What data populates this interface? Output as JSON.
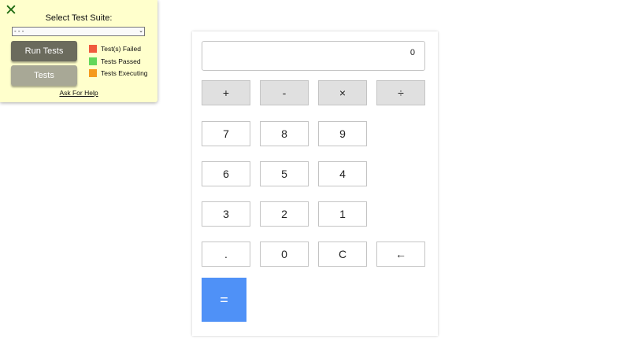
{
  "test_panel": {
    "close_icon_glyph": "✕",
    "title": "Select Test Suite:",
    "suite_select": {
      "selected": "- - -",
      "chevron": "⌄"
    },
    "run_button": "Run Tests",
    "tests_button": "Tests",
    "legend": [
      {
        "label": "Test(s) Failed",
        "color": "#f05a3c"
      },
      {
        "label": "Tests Passed",
        "color": "#62d75a"
      },
      {
        "label": "Tests Executing",
        "color": "#f59a1c"
      }
    ],
    "help_link": "Ask For Help"
  },
  "calculator": {
    "display_value": "0",
    "operators": {
      "add": "+",
      "subtract": "-",
      "multiply": "×",
      "divide": "÷"
    },
    "digits": {
      "seven": "7",
      "eight": "8",
      "nine": "9",
      "six": "6",
      "five": "5",
      "four": "4",
      "three": "3",
      "two": "2",
      "one": "1",
      "decimal": ".",
      "zero": "0"
    },
    "clear": "C",
    "backspace": "←",
    "equals": "="
  },
  "colors": {
    "panel_bg": "#ffffcc",
    "close_icon": "#1f6b12",
    "run_button": "#6b6b5d",
    "tests_button": "#a8a896",
    "equals_button": "#4f91f7",
    "operator_key": "#e0e0e0"
  }
}
